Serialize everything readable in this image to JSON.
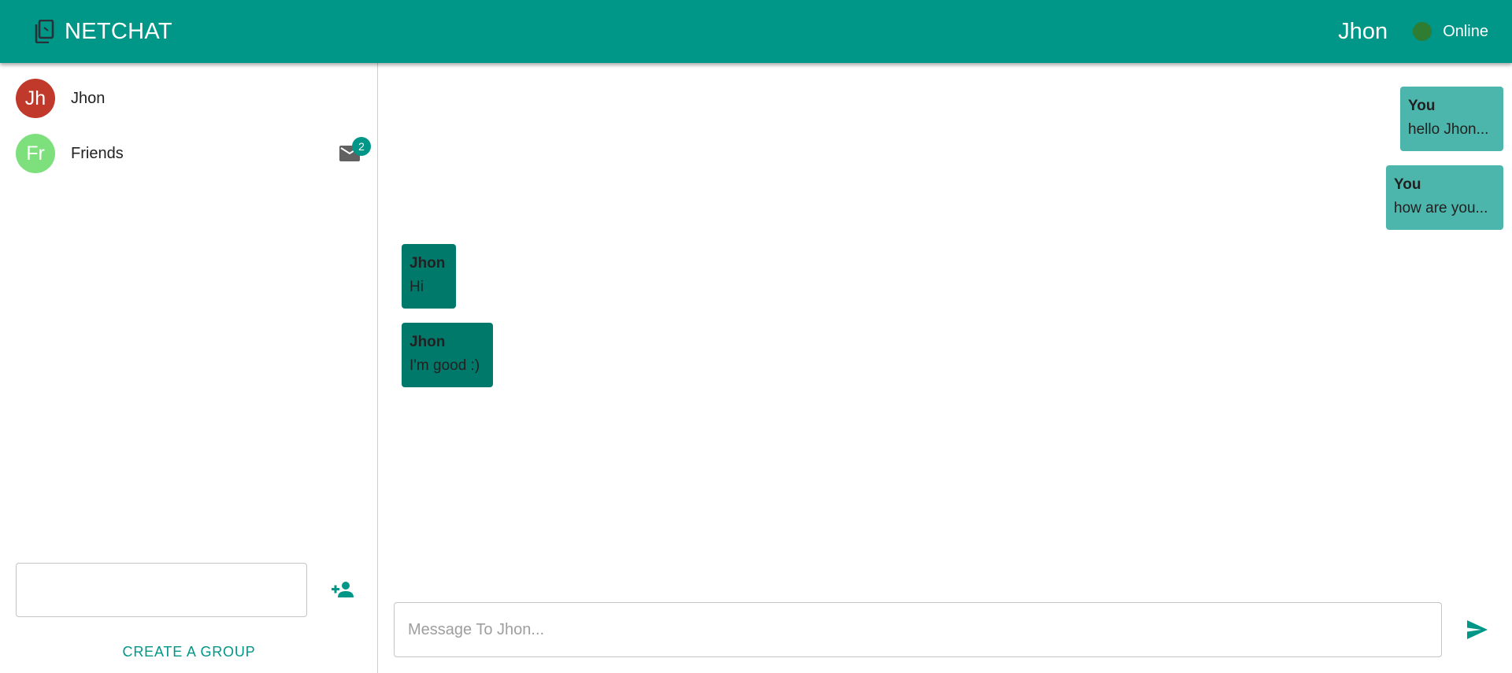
{
  "header": {
    "app_title": "NETCHAT",
    "current_user": "Jhon",
    "status": "Online"
  },
  "colors": {
    "primary": "#009688",
    "online": "#2e7d32",
    "outgoing_bubble": "#4db6ac",
    "incoming_bubble": "#00796b"
  },
  "sidebar": {
    "contacts": [
      {
        "initials": "Jh",
        "name": "Jhon",
        "avatar_color": "#c0392b"
      },
      {
        "initials": "Fr",
        "name": "Friends",
        "avatar_color": "#7de07d",
        "unread": "2",
        "icon": "mail-icon"
      }
    ],
    "group_input": {
      "value": "",
      "placeholder": ""
    },
    "add_person_icon": "person-add-icon",
    "create_group_label": "CREATE A GROUP"
  },
  "chat": {
    "messages": [
      {
        "sender": "You",
        "text": "hello Jhon...",
        "direction": "out"
      },
      {
        "sender": "You",
        "text": "how are you...",
        "direction": "out"
      },
      {
        "sender": "Jhon",
        "text": "Hi",
        "direction": "in"
      },
      {
        "sender": "Jhon",
        "text": "I'm good :)",
        "direction": "in"
      }
    ],
    "input": {
      "value": "",
      "placeholder": "Message To Jhon..."
    },
    "send_icon": "send-icon"
  }
}
